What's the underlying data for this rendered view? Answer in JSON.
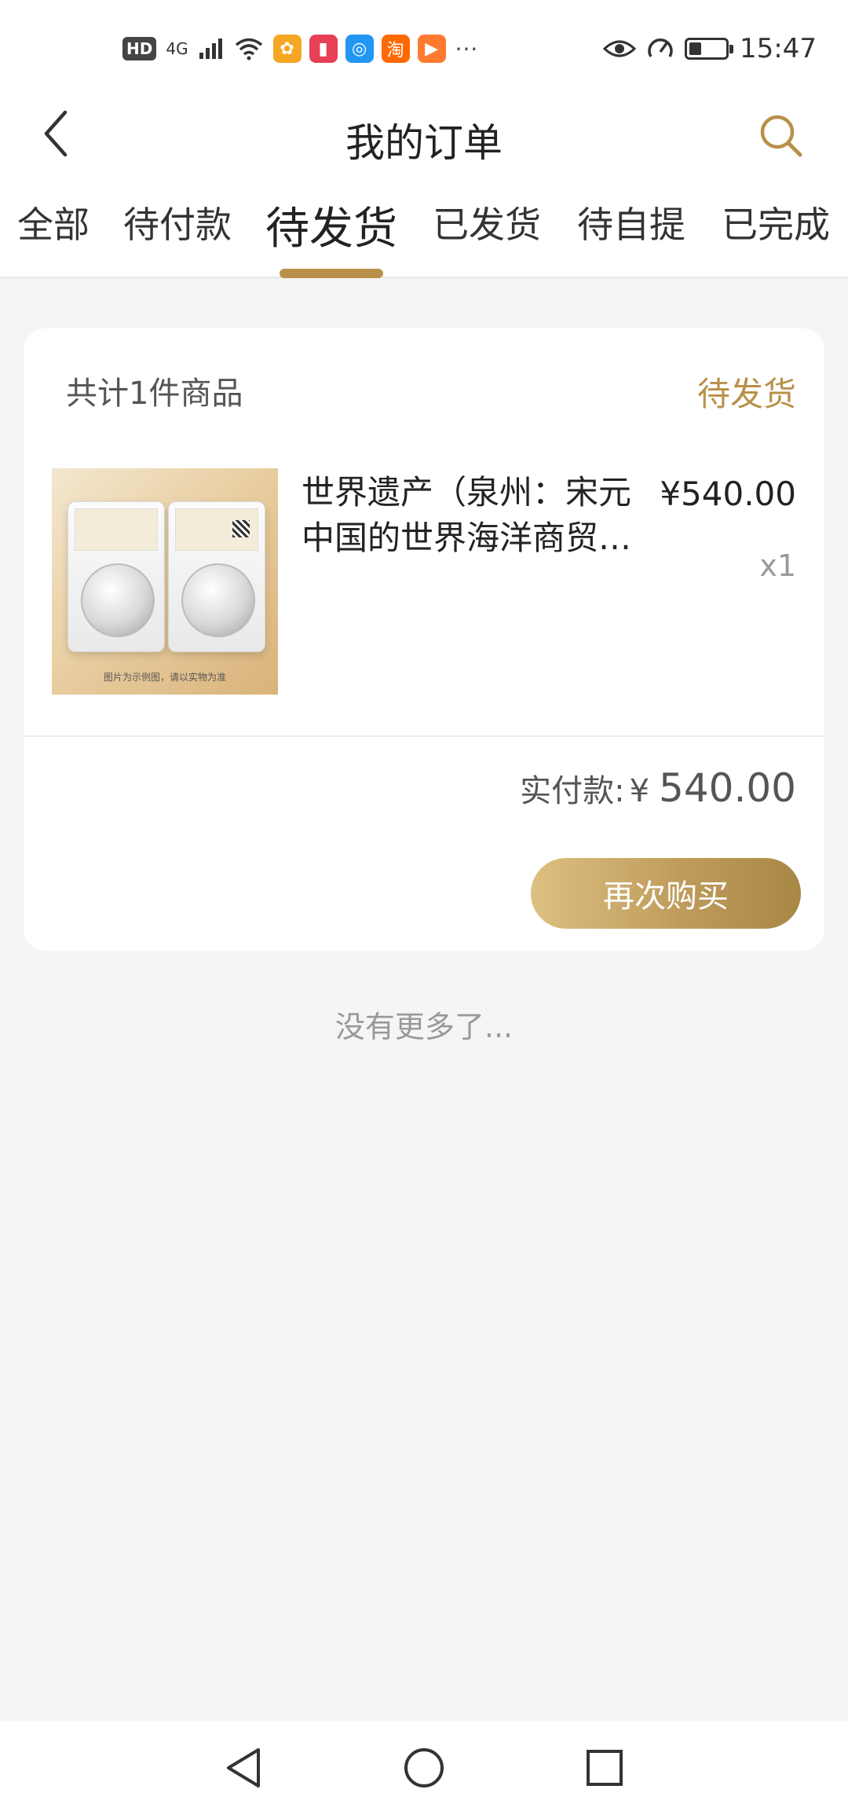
{
  "status_bar": {
    "hd": "HD",
    "network": "4G",
    "time": "15:47",
    "battery_level": 0.35,
    "app_icons": [
      {
        "name": "chat-app-icon",
        "glyph": "✿",
        "color": "#f5a623"
      },
      {
        "name": "book-app-icon",
        "glyph": "▮",
        "color": "#e84057"
      },
      {
        "name": "search-app-icon",
        "glyph": "◎",
        "color": "#2196f3"
      },
      {
        "name": "taobao-app-icon",
        "glyph": "淘",
        "color": "#ff6a00"
      },
      {
        "name": "video-app-icon",
        "glyph": "▶",
        "color": "#ff7a2f"
      }
    ],
    "more": "···"
  },
  "nav": {
    "title": "我的订单"
  },
  "tabs": [
    {
      "label": "全部",
      "active": false
    },
    {
      "label": "待付款",
      "active": false
    },
    {
      "label": "待发货",
      "active": true
    },
    {
      "label": "已发货",
      "active": false
    },
    {
      "label": "待自提",
      "active": false
    },
    {
      "label": "已完成",
      "active": false
    }
  ],
  "order": {
    "count_text": "共计1件商品",
    "status": "待发货",
    "product": {
      "name": "世界遗产（泉州：宋元中国的世界海洋商贸中心）",
      "price": "¥540.00",
      "qty": "x1",
      "image_caption": "图片为示例图，请以实物为准"
    },
    "paid_label": "实付款:",
    "paid_currency": "¥",
    "paid_amount": "540.00",
    "rebuy_label": "再次购买"
  },
  "footer_text": "没有更多了...",
  "colors": {
    "accent": "#b89048",
    "background": "#f5f5f5"
  }
}
